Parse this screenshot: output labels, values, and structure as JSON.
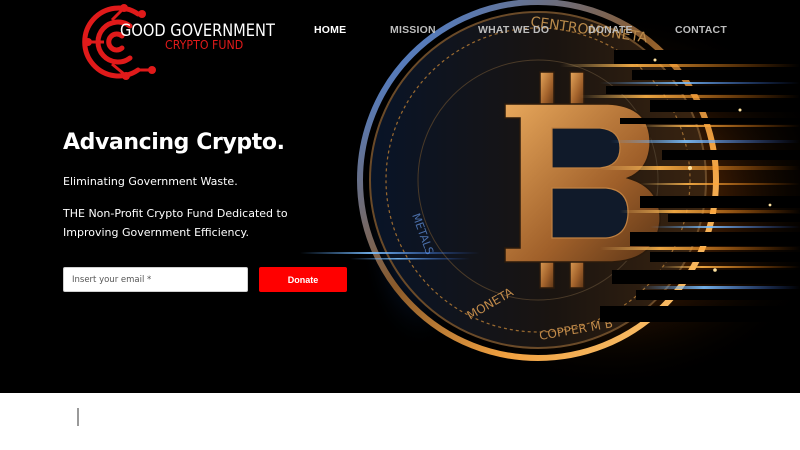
{
  "logo": {
    "title": "GOOD GOVERNMENT",
    "subtitle": "CRYPTO FUND"
  },
  "nav": {
    "items": [
      {
        "label": "HOME",
        "active": true
      },
      {
        "label": "MISSION",
        "active": false
      },
      {
        "label": "WHAT WE DO",
        "active": false
      },
      {
        "label": "DONATE",
        "active": false
      },
      {
        "label": "CONTACT",
        "active": false
      }
    ]
  },
  "hero": {
    "headline": "Advancing Crypto.",
    "tagline": "Eliminating Government Waste.",
    "description": "THE Non-Profit Crypto Fund Dedicated to Improving Government Efficiency.",
    "coin_text": "CENTROMONETA · BITCOIN · METALS · MONETA · COPPER M B · BRONZE",
    "email_placeholder": "Insert your email *",
    "donate_label": "Donate"
  },
  "colors": {
    "accent": "#ff0000",
    "logo_red": "#e01a1a",
    "hero_bg": "#000000",
    "nav_inactive": "#bdbdbd",
    "nav_active": "#ffffff"
  },
  "icons": {
    "logo_mark": "circuit-c-logo-icon",
    "hero_art": "bitcoin-coin-illustration"
  }
}
